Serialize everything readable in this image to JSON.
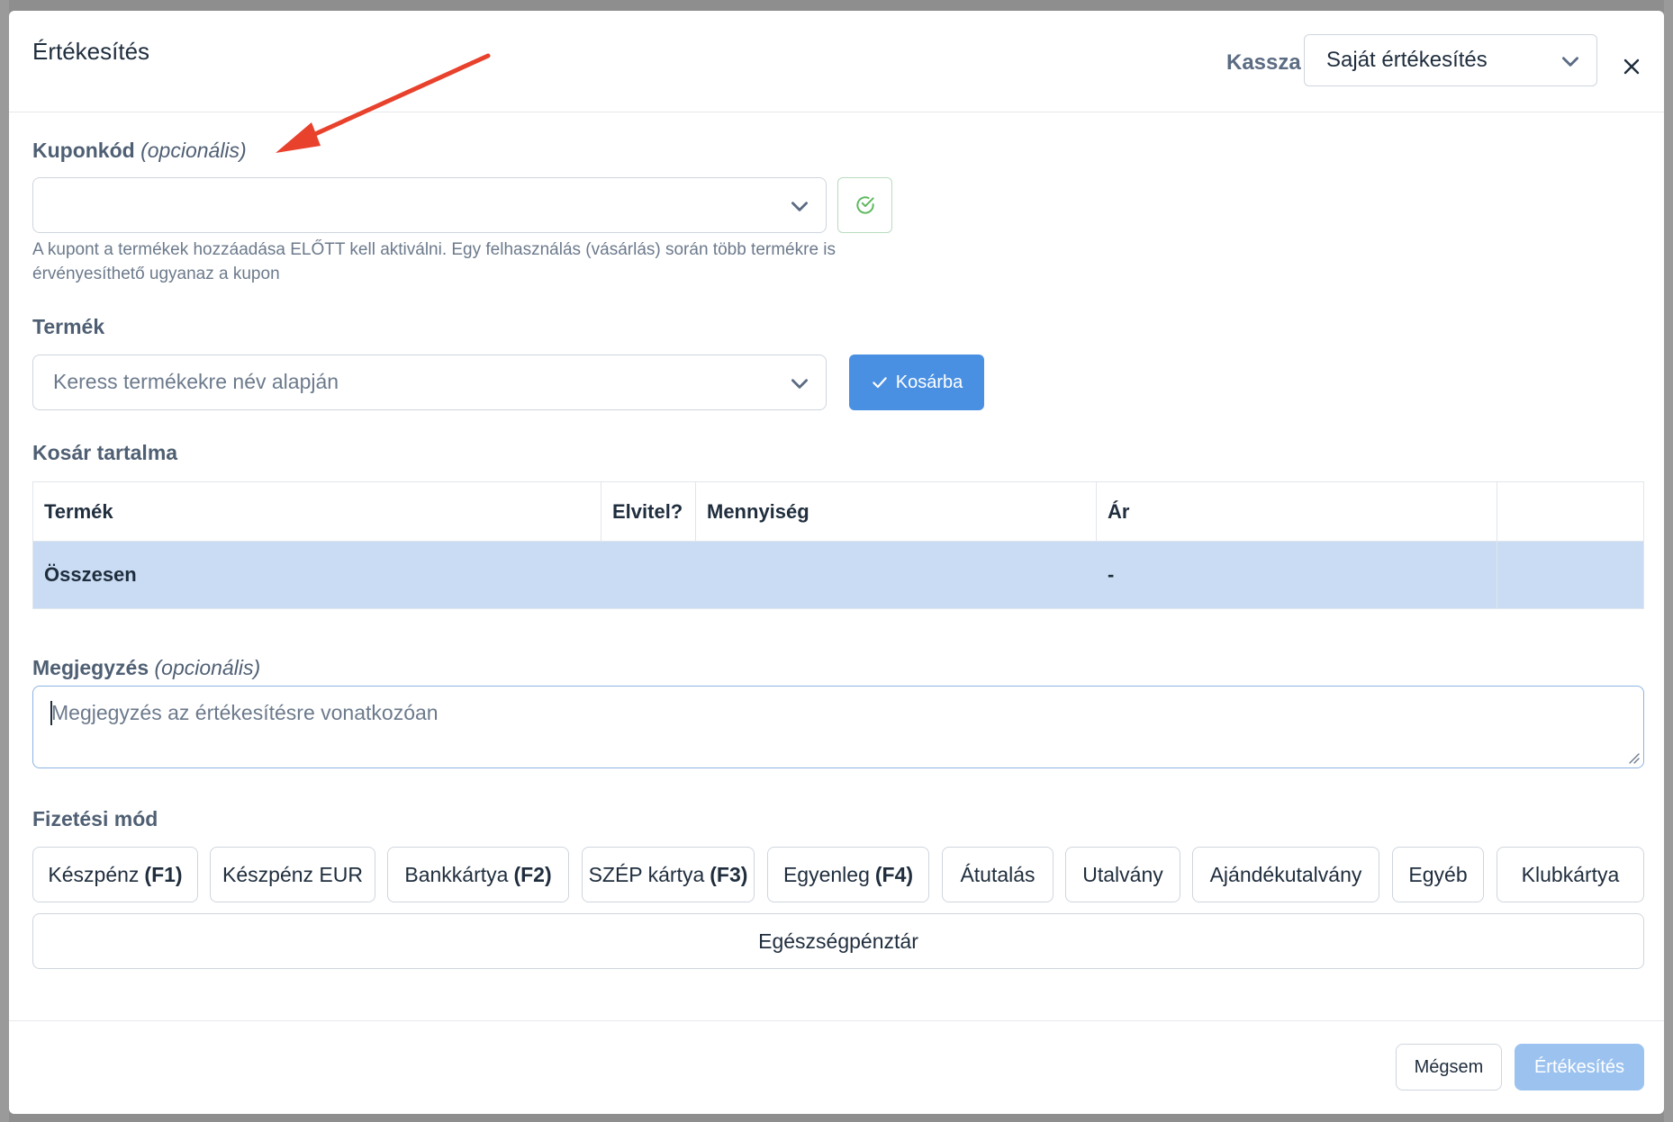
{
  "modal": {
    "title": "Értékesítés",
    "kassza_label": "Kassza",
    "kassza_value": "Saját értékesítés"
  },
  "coupon": {
    "label": "Kuponkód",
    "optional": "(opcionális)",
    "value": "",
    "hint": "A kupont a termékek hozzáadása ELŐTT kell aktiválni. Egy felhasználás (vásárlás) során több termékre is érvényesíthető ugyanaz a kupon"
  },
  "product": {
    "label": "Termék",
    "placeholder": "Keress termékekre név alapján",
    "add_button": "Kosárba"
  },
  "cart": {
    "label": "Kosár tartalma",
    "columns": [
      "Termék",
      "Elvitel?",
      "Mennyiség",
      "Ár",
      ""
    ],
    "total_label": "Összesen",
    "total_value": "-"
  },
  "note": {
    "label": "Megjegyzés",
    "optional": "(opcionális)",
    "placeholder": "Megjegyzés az értékesítésre vonatkozóan"
  },
  "payment": {
    "label": "Fizetési mód",
    "methods": [
      {
        "name": "Készpénz",
        "key": "(F1)"
      },
      {
        "name": "Készpénz EUR",
        "key": ""
      },
      {
        "name": "Bankkártya",
        "key": "(F2)"
      },
      {
        "name": "SZÉP kártya",
        "key": "(F3)"
      },
      {
        "name": "Egyenleg",
        "key": "(F4)"
      },
      {
        "name": "Átutalás",
        "key": ""
      },
      {
        "name": "Utalvány",
        "key": ""
      },
      {
        "name": "Ajándékutalvány",
        "key": ""
      },
      {
        "name": "Egyéb",
        "key": ""
      },
      {
        "name": "Klubkártya",
        "key": ""
      }
    ],
    "wide_method": "Egészségpénztár"
  },
  "footer": {
    "cancel": "Mégsem",
    "submit": "Értékesítés"
  },
  "colors": {
    "primary": "#4a90e2",
    "primary_disabled": "#9cc3ef",
    "total_row": "#c9dcf3",
    "annotation_arrow": "#e8412c",
    "success": "#5cb85c"
  }
}
